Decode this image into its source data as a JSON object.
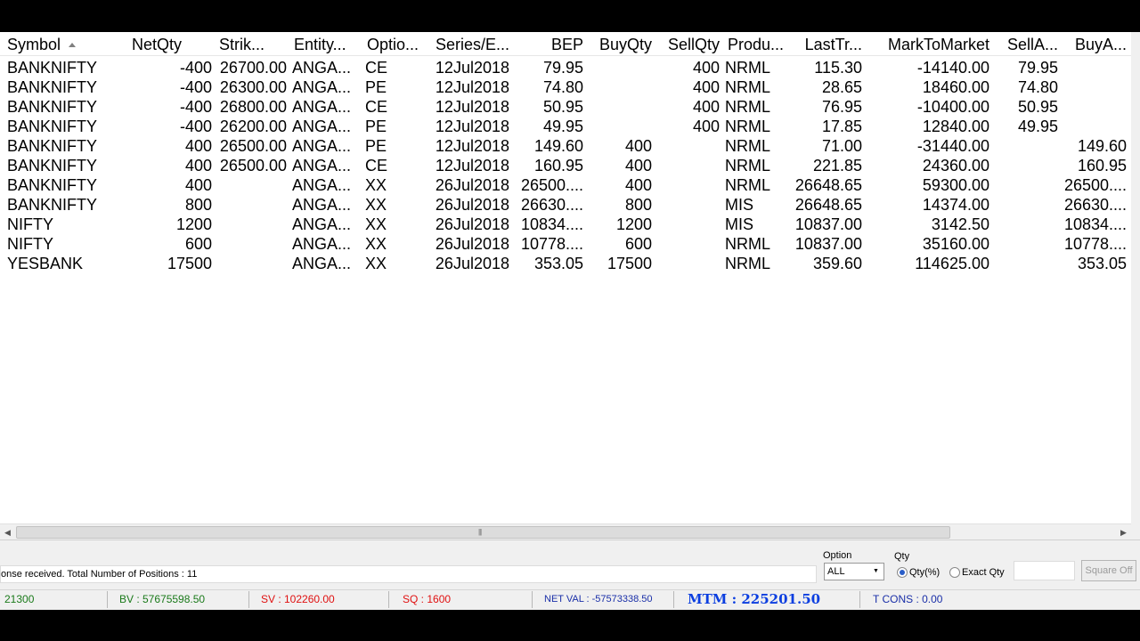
{
  "table": {
    "columns": [
      "Symbol",
      "NetQty",
      "Strik...",
      "Entity...",
      "Optio...",
      "Series/E...",
      "BEP",
      "BuyQty",
      "SellQty",
      "Produ...",
      "LastTr...",
      "MarkToMarket",
      "SellA...",
      "BuyA..."
    ],
    "rows": [
      [
        "BANKNIFTY",
        "-400",
        "26700.00",
        "ANGA...",
        "CE",
        "12Jul2018",
        "79.95",
        "",
        "400",
        "NRML",
        "115.30",
        "-14140.00",
        "79.95",
        ""
      ],
      [
        "BANKNIFTY",
        "-400",
        "26300.00",
        "ANGA...",
        "PE",
        "12Jul2018",
        "74.80",
        "",
        "400",
        "NRML",
        "28.65",
        "18460.00",
        "74.80",
        ""
      ],
      [
        "BANKNIFTY",
        "-400",
        "26800.00",
        "ANGA...",
        "CE",
        "12Jul2018",
        "50.95",
        "",
        "400",
        "NRML",
        "76.95",
        "-10400.00",
        "50.95",
        ""
      ],
      [
        "BANKNIFTY",
        "-400",
        "26200.00",
        "ANGA...",
        "PE",
        "12Jul2018",
        "49.95",
        "",
        "400",
        "NRML",
        "17.85",
        "12840.00",
        "49.95",
        ""
      ],
      [
        "BANKNIFTY",
        "400",
        "26500.00",
        "ANGA...",
        "PE",
        "12Jul2018",
        "149.60",
        "400",
        "",
        "NRML",
        "71.00",
        "-31440.00",
        "",
        "149.60"
      ],
      [
        "BANKNIFTY",
        "400",
        "26500.00",
        "ANGA...",
        "CE",
        "12Jul2018",
        "160.95",
        "400",
        "",
        "NRML",
        "221.85",
        "24360.00",
        "",
        "160.95"
      ],
      [
        "BANKNIFTY",
        "400",
        "",
        "ANGA...",
        "XX",
        "26Jul2018",
        "26500....",
        "400",
        "",
        "NRML",
        "26648.65",
        "59300.00",
        "",
        "26500...."
      ],
      [
        "BANKNIFTY",
        "800",
        "",
        "ANGA...",
        "XX",
        "26Jul2018",
        "26630....",
        "800",
        "",
        "MIS",
        "26648.65",
        "14374.00",
        "",
        "26630...."
      ],
      [
        "NIFTY",
        "1200",
        "",
        "ANGA...",
        "XX",
        "26Jul2018",
        "10834....",
        "1200",
        "",
        "MIS",
        "10837.00",
        "3142.50",
        "",
        "10834...."
      ],
      [
        "NIFTY",
        "600",
        "",
        "ANGA...",
        "XX",
        "26Jul2018",
        "10778....",
        "600",
        "",
        "NRML",
        "10837.00",
        "35160.00",
        "",
        "10778...."
      ],
      [
        "YESBANK",
        "17500",
        "",
        "ANGA...",
        "XX",
        "26Jul2018",
        "353.05",
        "17500",
        "",
        "NRML",
        "359.60",
        "114625.00",
        "",
        "353.05"
      ]
    ]
  },
  "controls": {
    "status_message": "onse received. Total Number of Positions : 11",
    "option_label": "Option",
    "option_value": "ALL",
    "qty_label": "Qty",
    "radio_qty_pct": "Qty(%)",
    "radio_exact_qty": "Exact Qty",
    "square_off": "Square Off"
  },
  "statusbar": {
    "first": "21300",
    "bv": "BV : 57675598.50",
    "sv": "SV : 102260.00",
    "sq": "SQ : 1600",
    "net_val": "NET VAL : -57573338.50",
    "mtm": "MTM : 225201.50",
    "tcons": "T CONS : 0.00"
  },
  "colors": {
    "bv": "#1a7a1a",
    "sv": "#e01010",
    "net_val": "#1a2fa8",
    "mtm": "#0b3ee0",
    "first": "#1a7a1a",
    "sq": "#e01010",
    "tcons": "#1a2fa8"
  },
  "icons": [
    "sort-ascending-icon",
    "scroll-left-arrow-icon",
    "scroll-right-arrow-icon",
    "dropdown-caret-icon"
  ]
}
